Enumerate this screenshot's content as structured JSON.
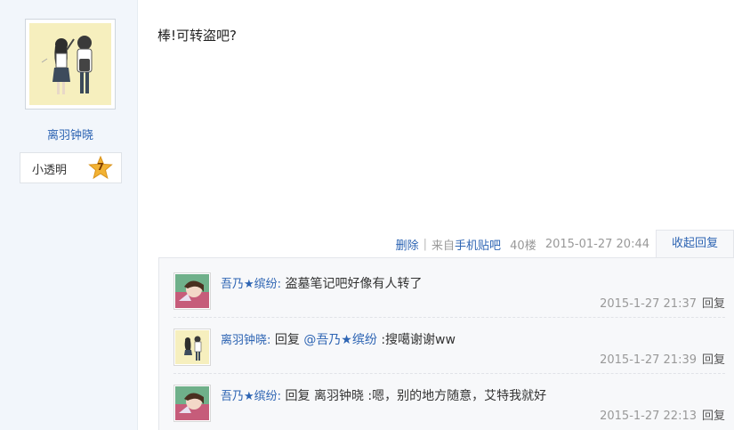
{
  "author": {
    "name": "离羽钟晓",
    "level_title": "小透明",
    "level_number": "7"
  },
  "post": {
    "content": "棒!可转盗吧?"
  },
  "tail": {
    "delete_label": "删除",
    "separator": "|",
    "from_prefix": "来自",
    "from_source": "手机贴吧",
    "floor": "40楼",
    "timestamp": "2015-01-27 20:44",
    "toggle_label": "收起回复"
  },
  "replies": [
    {
      "user": "吾乃★缤纷",
      "colon": ":",
      "text": " 盗墓笔记吧好像有人转了",
      "time": "2015-1-27 21:37",
      "reply_label": "回复"
    },
    {
      "user": "离羽钟晓",
      "colon": ":",
      "prefix": " 回复 ",
      "mention": "@吾乃★缤纷",
      "text": " :搜噶谢谢ww",
      "time": "2015-1-27 21:39",
      "reply_label": "回复"
    },
    {
      "user": "吾乃★缤纷",
      "colon": ":",
      "text": " 回复 离羽钟晓 :嗯，别的地方随意，艾特我就好",
      "time": "2015-1-27 22:13",
      "reply_label": "回复"
    }
  ],
  "colors": {
    "link": "#2d64b3",
    "sidebar_bg": "#f2f6fb",
    "reply_bg": "#f7f8fa",
    "meta_gray": "#999999",
    "level_badge": "#f2b233"
  }
}
